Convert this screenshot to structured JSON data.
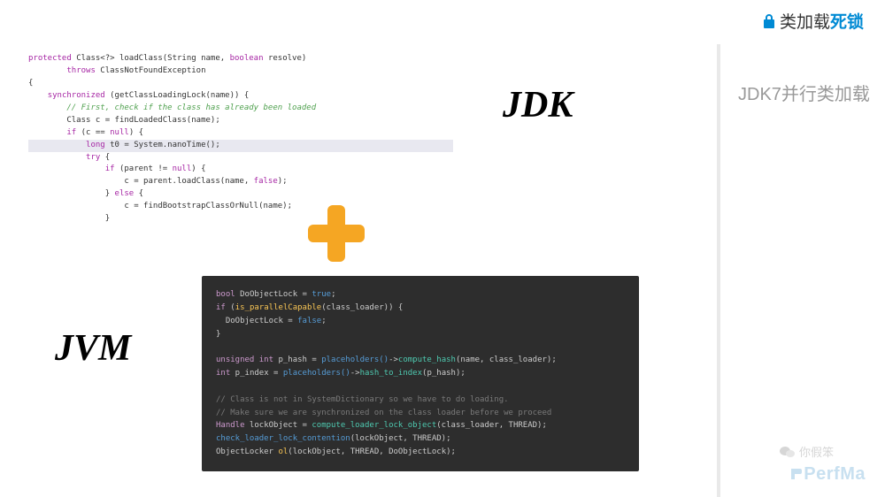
{
  "top_brand": {
    "prefix": "类加载",
    "suffix": "死锁"
  },
  "right_title": "JDK7并行类加载",
  "jdk_label": "JDK",
  "jvm_label": "JVM",
  "java_code": {
    "l1a": "protected",
    "l1b": " Class<?> loadClass(String name, ",
    "l1c": "boolean",
    "l1d": " resolve)",
    "l2a": "        ",
    "l2b": "throws",
    "l2c": " ClassNotFoundException",
    "l3": "{",
    "l4a": "    ",
    "l4b": "synchronized",
    "l4c": " (getClassLoadingLock(name)) {",
    "l5a": "        ",
    "l5b": "// First, check if the class has already been loaded",
    "l6": "        Class c = findLoadedClass(name);",
    "l7a": "        ",
    "l7b": "if",
    "l7c": " (c == ",
    "l7d": "null",
    "l7e": ") {",
    "l8a": "            ",
    "l8b": "long",
    "l8c": " t0 = System.nanoTime();",
    "l9a": "            ",
    "l9b": "try",
    "l9c": " {",
    "l10a": "                ",
    "l10b": "if",
    "l10c": " (parent != ",
    "l10d": "null",
    "l10e": ") {",
    "l11": "                    c = parent.loadClass(name, ",
    "l11b": "false",
    "l11c": ");",
    "l12a": "                } ",
    "l12b": "else",
    "l12c": " {",
    "l13": "                    c = findBootstrapClassOrNull(name);",
    "l14": "                }"
  },
  "cpp_code": {
    "l1a": "bool",
    "l1b": " DoObjectLock = ",
    "l1c": "true",
    "l1d": ";",
    "l2a": "if",
    "l2b": " (",
    "l2c": "is_parallelCapable",
    "l2d": "(class_loader)) {",
    "l3a": "  DoObjectLock = ",
    "l3b": "false",
    "l3c": ";",
    "l4": "}",
    "l5": "",
    "l6a": "unsigned int",
    "l6b": " p_hash = ",
    "l6c": "placeholders()",
    "l6d": "->",
    "l6e": "compute_hash",
    "l6f": "(name, class_loader);",
    "l7a": "int",
    "l7b": " p_index = ",
    "l7c": "placeholders()",
    "l7d": "->",
    "l7e": "hash_to_index",
    "l7f": "(p_hash);",
    "l8": "",
    "l9": "// Class is not in SystemDictionary so we have to do loading.",
    "l10": "// Make sure we are synchronized on the class loader before we proceed",
    "l11a": "Handle",
    "l11b": " lockObject = ",
    "l11c": "compute_loader_lock_object",
    "l11d": "(class_loader, THREAD);",
    "l12a": "check_loader_lock_contention",
    "l12b": "(lockObject, THREAD);",
    "l13a": "ObjectLocker ",
    "l13b": "ol",
    "l13c": "(lockObject, THREAD, DoObjectLock);"
  },
  "footer_brand": "PerfMa",
  "wechat_name": "你假笨"
}
